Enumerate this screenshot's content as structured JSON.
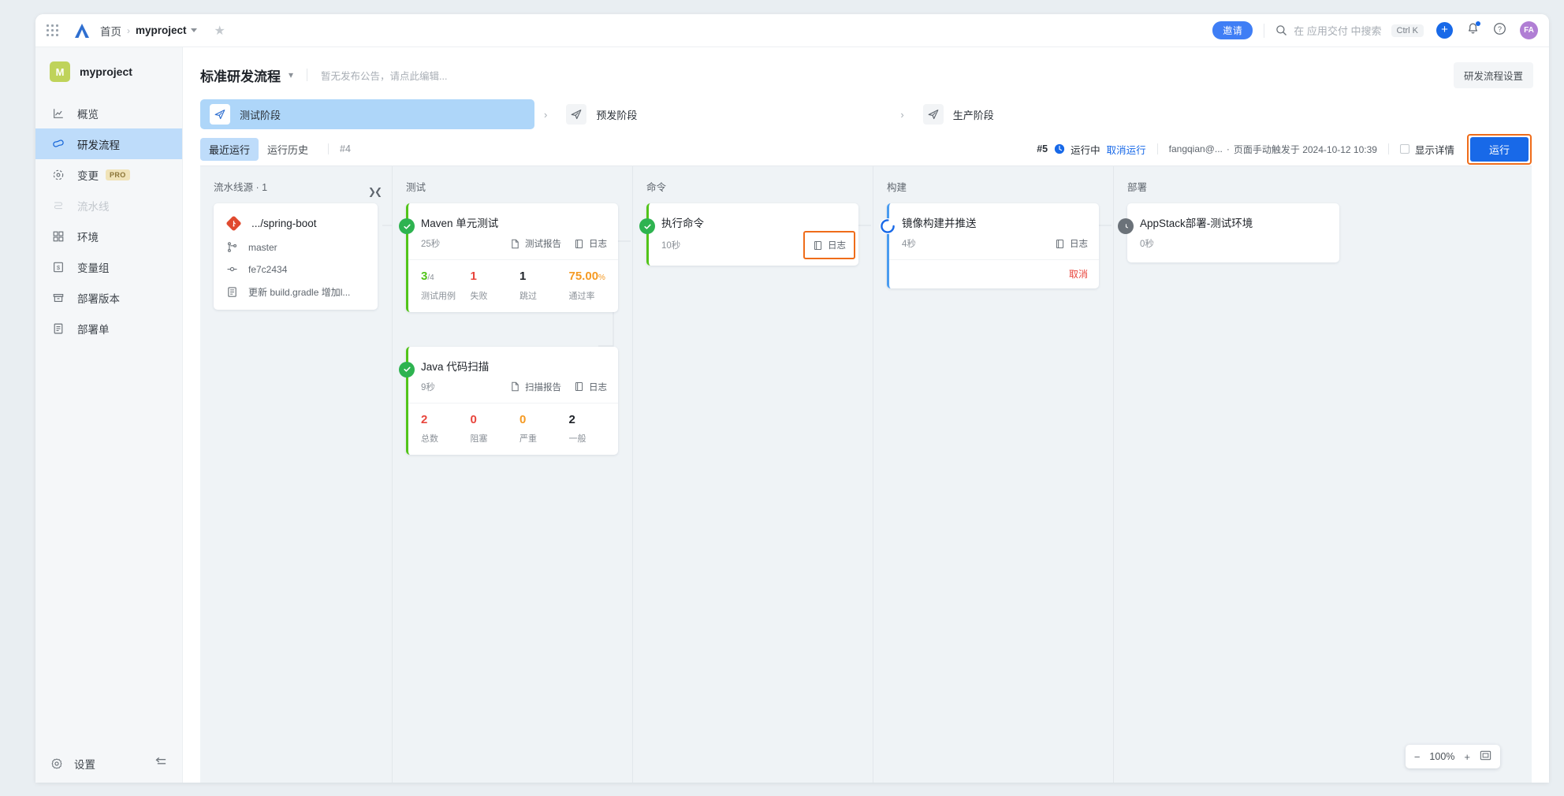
{
  "topbar": {
    "grid_icon": "apps-grid-icon",
    "logo": "aliyun-logo-icon",
    "breadcrumb_home": "首页",
    "breadcrumb_project": "myproject",
    "star_icon": "star-icon",
    "invite_label": "邀请",
    "search_placeholder": "在 应用交付 中搜索",
    "search_shortcut": "Ctrl K",
    "plus_label": "+",
    "bell_icon": "bell-icon",
    "help_icon": "help-circle-icon",
    "avatar_initials": "FA"
  },
  "sidebar": {
    "project_badge": "M",
    "project_name": "myproject",
    "items": [
      {
        "label": "概览",
        "icon": "chart-icon",
        "active": false,
        "disabled": false
      },
      {
        "label": "研发流程",
        "icon": "infinity-icon",
        "active": true,
        "disabled": false
      },
      {
        "label": "变更",
        "icon": "change-icon",
        "active": false,
        "disabled": false,
        "tag": "PRO"
      },
      {
        "label": "流水线",
        "icon": "pipeline-icon",
        "active": false,
        "disabled": true
      },
      {
        "label": "环境",
        "icon": "env-icon",
        "active": false,
        "disabled": false
      },
      {
        "label": "变量组",
        "icon": "variable-icon",
        "active": false,
        "disabled": false
      },
      {
        "label": "部署版本",
        "icon": "package-icon",
        "active": false,
        "disabled": false
      },
      {
        "label": "部署单",
        "icon": "document-icon",
        "active": false,
        "disabled": false
      }
    ],
    "settings_label": "设置",
    "settings_icon": "gear-icon",
    "collapse_icon": "collapse-sidebar-icon"
  },
  "header": {
    "title": "标准研发流程",
    "notice": "暂无发布公告，请点此编辑...",
    "settings_button": "研发流程设置"
  },
  "stages": [
    {
      "label": "测试阶段",
      "active": true
    },
    {
      "label": "预发阶段",
      "active": false
    },
    {
      "label": "生产阶段",
      "active": false
    }
  ],
  "runbar": {
    "tab_latest": "最近运行",
    "tab_history": "运行历史",
    "build_ref": "#4",
    "run_id": "#5",
    "run_state": "运行中",
    "cancel_run": "取消运行",
    "trigger_user": "fangqian@...",
    "trigger_info": "页面手动触发于 2024-10-12 10:39",
    "show_detail": "显示详情",
    "run_button": "运行"
  },
  "columns": [
    {
      "title": "流水线源 · 1",
      "kind": "source"
    },
    {
      "title": "测试",
      "kind": "jobs"
    },
    {
      "title": "命令",
      "kind": "jobs"
    },
    {
      "title": "构建",
      "kind": "jobs"
    },
    {
      "title": "部署",
      "kind": "jobs"
    }
  ],
  "source_card": {
    "repo_icon": "git-repo-icon",
    "repo": ".../spring-boot",
    "branch_icon": "branch-icon",
    "branch": "master",
    "commit_icon": "commit-icon",
    "commit": "fe7c2434",
    "message_icon": "commit-message-icon",
    "message": "更新 build.gradle 增加l..."
  },
  "jobs": {
    "maven": {
      "title": "Maven 单元测试",
      "duration": "25秒",
      "status": "success",
      "actions": [
        {
          "label": "测试报告",
          "icon": "report-icon",
          "highlighted": false
        },
        {
          "label": "日志",
          "icon": "log-icon",
          "highlighted": false
        }
      ],
      "stats": [
        {
          "value": "3",
          "suffix": "/4",
          "label": "测试用例",
          "color": "#52c41a"
        },
        {
          "value": "1",
          "suffix": "",
          "label": "失败",
          "color": "#e8453c"
        },
        {
          "value": "1",
          "suffix": "",
          "label": "跳过",
          "color": "#1f2329"
        },
        {
          "value": "75.00",
          "suffix": "%",
          "label": "通过率",
          "color": "#f59a23"
        }
      ]
    },
    "java_scan": {
      "title": "Java 代码扫描",
      "duration": "9秒",
      "status": "success",
      "actions": [
        {
          "label": "扫描报告",
          "icon": "report-icon",
          "highlighted": false
        },
        {
          "label": "日志",
          "icon": "log-icon",
          "highlighted": false
        }
      ],
      "stats": [
        {
          "value": "2",
          "suffix": "",
          "label": "总数",
          "color": "#e8453c"
        },
        {
          "value": "0",
          "suffix": "",
          "label": "阻塞",
          "color": "#e8453c"
        },
        {
          "value": "0",
          "suffix": "",
          "label": "严重",
          "color": "#f59a23"
        },
        {
          "value": "2",
          "suffix": "",
          "label": "一般",
          "color": "#1f2329"
        }
      ]
    },
    "command": {
      "title": "执行命令",
      "duration": "10秒",
      "status": "success",
      "actions": [
        {
          "label": "日志",
          "icon": "log-icon",
          "highlighted": true
        }
      ]
    },
    "image_build": {
      "title": "镜像构建并推送",
      "duration": "4秒",
      "status": "running",
      "actions": [
        {
          "label": "日志",
          "icon": "log-icon",
          "highlighted": false
        }
      ],
      "cancel_label": "取消"
    },
    "appstack_deploy": {
      "title": "AppStack部署-测试环境",
      "duration": "0秒",
      "status": "waiting",
      "actions": []
    }
  },
  "zoom_control": {
    "minus": "−",
    "value": "100%",
    "plus": "+",
    "fit_icon": "fit-screen-icon"
  },
  "colors": {
    "accent_blue": "#1869e8",
    "success_green": "#52c41a",
    "error_red": "#e8453c",
    "warn_orange": "#f59a23",
    "highlight_orange": "#ef6c1a",
    "active_tab_blue": "#bedcfa"
  }
}
